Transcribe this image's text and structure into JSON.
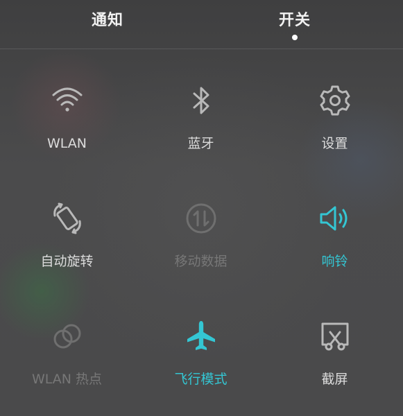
{
  "tabs": [
    {
      "label": "通知",
      "selected": false
    },
    {
      "label": "开关",
      "selected": true
    }
  ],
  "colors": {
    "active": "#34c6d3",
    "normal_icon": "#b9b9b9",
    "disabled_icon": "#6f6f6f",
    "normal_text": "#dcdcdc",
    "disabled_text": "#777777"
  },
  "toggles": [
    {
      "label": "WLAN",
      "icon": "wifi-icon",
      "state": "normal"
    },
    {
      "label": "蓝牙",
      "icon": "bluetooth-icon",
      "state": "normal"
    },
    {
      "label": "设置",
      "icon": "gear-icon",
      "state": "normal"
    },
    {
      "label": "自动旋转",
      "icon": "rotate-icon",
      "state": "normal"
    },
    {
      "label": "移动数据",
      "icon": "mobile-data-icon",
      "state": "disabled"
    },
    {
      "label": "响铃",
      "icon": "speaker-icon",
      "state": "active"
    },
    {
      "label": "WLAN 热点",
      "icon": "hotspot-icon",
      "state": "disabled"
    },
    {
      "label": "飞行模式",
      "icon": "airplane-icon",
      "state": "active"
    },
    {
      "label": "截屏",
      "icon": "screenshot-icon",
      "state": "normal"
    }
  ]
}
